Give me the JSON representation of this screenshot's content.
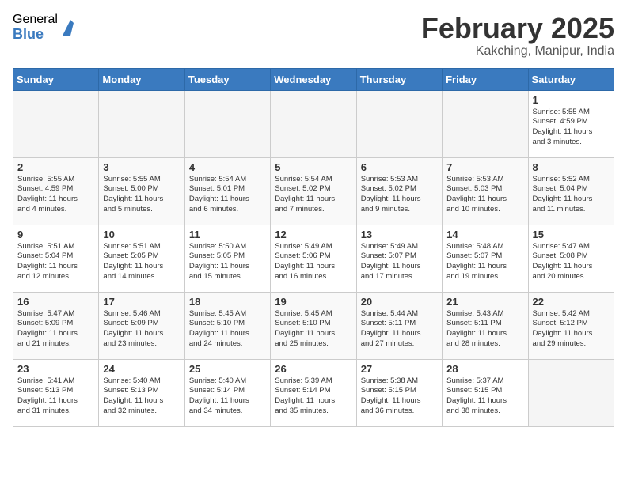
{
  "header": {
    "logo_general": "General",
    "logo_blue": "Blue",
    "month_year": "February 2025",
    "location": "Kakching, Manipur, India"
  },
  "days_of_week": [
    "Sunday",
    "Monday",
    "Tuesday",
    "Wednesday",
    "Thursday",
    "Friday",
    "Saturday"
  ],
  "weeks": [
    [
      {
        "day": "",
        "info": ""
      },
      {
        "day": "",
        "info": ""
      },
      {
        "day": "",
        "info": ""
      },
      {
        "day": "",
        "info": ""
      },
      {
        "day": "",
        "info": ""
      },
      {
        "day": "",
        "info": ""
      },
      {
        "day": "1",
        "info": "Sunrise: 5:55 AM\nSunset: 4:59 PM\nDaylight: 11 hours\nand 3 minutes."
      }
    ],
    [
      {
        "day": "2",
        "info": "Sunrise: 5:55 AM\nSunset: 4:59 PM\nDaylight: 11 hours\nand 4 minutes."
      },
      {
        "day": "3",
        "info": "Sunrise: 5:55 AM\nSunset: 5:00 PM\nDaylight: 11 hours\nand 5 minutes."
      },
      {
        "day": "4",
        "info": "Sunrise: 5:54 AM\nSunset: 5:01 PM\nDaylight: 11 hours\nand 6 minutes."
      },
      {
        "day": "5",
        "info": "Sunrise: 5:54 AM\nSunset: 5:02 PM\nDaylight: 11 hours\nand 7 minutes."
      },
      {
        "day": "6",
        "info": "Sunrise: 5:53 AM\nSunset: 5:02 PM\nDaylight: 11 hours\nand 9 minutes."
      },
      {
        "day": "7",
        "info": "Sunrise: 5:53 AM\nSunset: 5:03 PM\nDaylight: 11 hours\nand 10 minutes."
      },
      {
        "day": "8",
        "info": "Sunrise: 5:52 AM\nSunset: 5:04 PM\nDaylight: 11 hours\nand 11 minutes."
      }
    ],
    [
      {
        "day": "9",
        "info": "Sunrise: 5:51 AM\nSunset: 5:04 PM\nDaylight: 11 hours\nand 12 minutes."
      },
      {
        "day": "10",
        "info": "Sunrise: 5:51 AM\nSunset: 5:05 PM\nDaylight: 11 hours\nand 14 minutes."
      },
      {
        "day": "11",
        "info": "Sunrise: 5:50 AM\nSunset: 5:05 PM\nDaylight: 11 hours\nand 15 minutes."
      },
      {
        "day": "12",
        "info": "Sunrise: 5:49 AM\nSunset: 5:06 PM\nDaylight: 11 hours\nand 16 minutes."
      },
      {
        "day": "13",
        "info": "Sunrise: 5:49 AM\nSunset: 5:07 PM\nDaylight: 11 hours\nand 17 minutes."
      },
      {
        "day": "14",
        "info": "Sunrise: 5:48 AM\nSunset: 5:07 PM\nDaylight: 11 hours\nand 19 minutes."
      },
      {
        "day": "15",
        "info": "Sunrise: 5:47 AM\nSunset: 5:08 PM\nDaylight: 11 hours\nand 20 minutes."
      }
    ],
    [
      {
        "day": "16",
        "info": "Sunrise: 5:47 AM\nSunset: 5:09 PM\nDaylight: 11 hours\nand 21 minutes."
      },
      {
        "day": "17",
        "info": "Sunrise: 5:46 AM\nSunset: 5:09 PM\nDaylight: 11 hours\nand 23 minutes."
      },
      {
        "day": "18",
        "info": "Sunrise: 5:45 AM\nSunset: 5:10 PM\nDaylight: 11 hours\nand 24 minutes."
      },
      {
        "day": "19",
        "info": "Sunrise: 5:45 AM\nSunset: 5:10 PM\nDaylight: 11 hours\nand 25 minutes."
      },
      {
        "day": "20",
        "info": "Sunrise: 5:44 AM\nSunset: 5:11 PM\nDaylight: 11 hours\nand 27 minutes."
      },
      {
        "day": "21",
        "info": "Sunrise: 5:43 AM\nSunset: 5:11 PM\nDaylight: 11 hours\nand 28 minutes."
      },
      {
        "day": "22",
        "info": "Sunrise: 5:42 AM\nSunset: 5:12 PM\nDaylight: 11 hours\nand 29 minutes."
      }
    ],
    [
      {
        "day": "23",
        "info": "Sunrise: 5:41 AM\nSunset: 5:13 PM\nDaylight: 11 hours\nand 31 minutes."
      },
      {
        "day": "24",
        "info": "Sunrise: 5:40 AM\nSunset: 5:13 PM\nDaylight: 11 hours\nand 32 minutes."
      },
      {
        "day": "25",
        "info": "Sunrise: 5:40 AM\nSunset: 5:14 PM\nDaylight: 11 hours\nand 34 minutes."
      },
      {
        "day": "26",
        "info": "Sunrise: 5:39 AM\nSunset: 5:14 PM\nDaylight: 11 hours\nand 35 minutes."
      },
      {
        "day": "27",
        "info": "Sunrise: 5:38 AM\nSunset: 5:15 PM\nDaylight: 11 hours\nand 36 minutes."
      },
      {
        "day": "28",
        "info": "Sunrise: 5:37 AM\nSunset: 5:15 PM\nDaylight: 11 hours\nand 38 minutes."
      },
      {
        "day": "",
        "info": ""
      }
    ]
  ]
}
